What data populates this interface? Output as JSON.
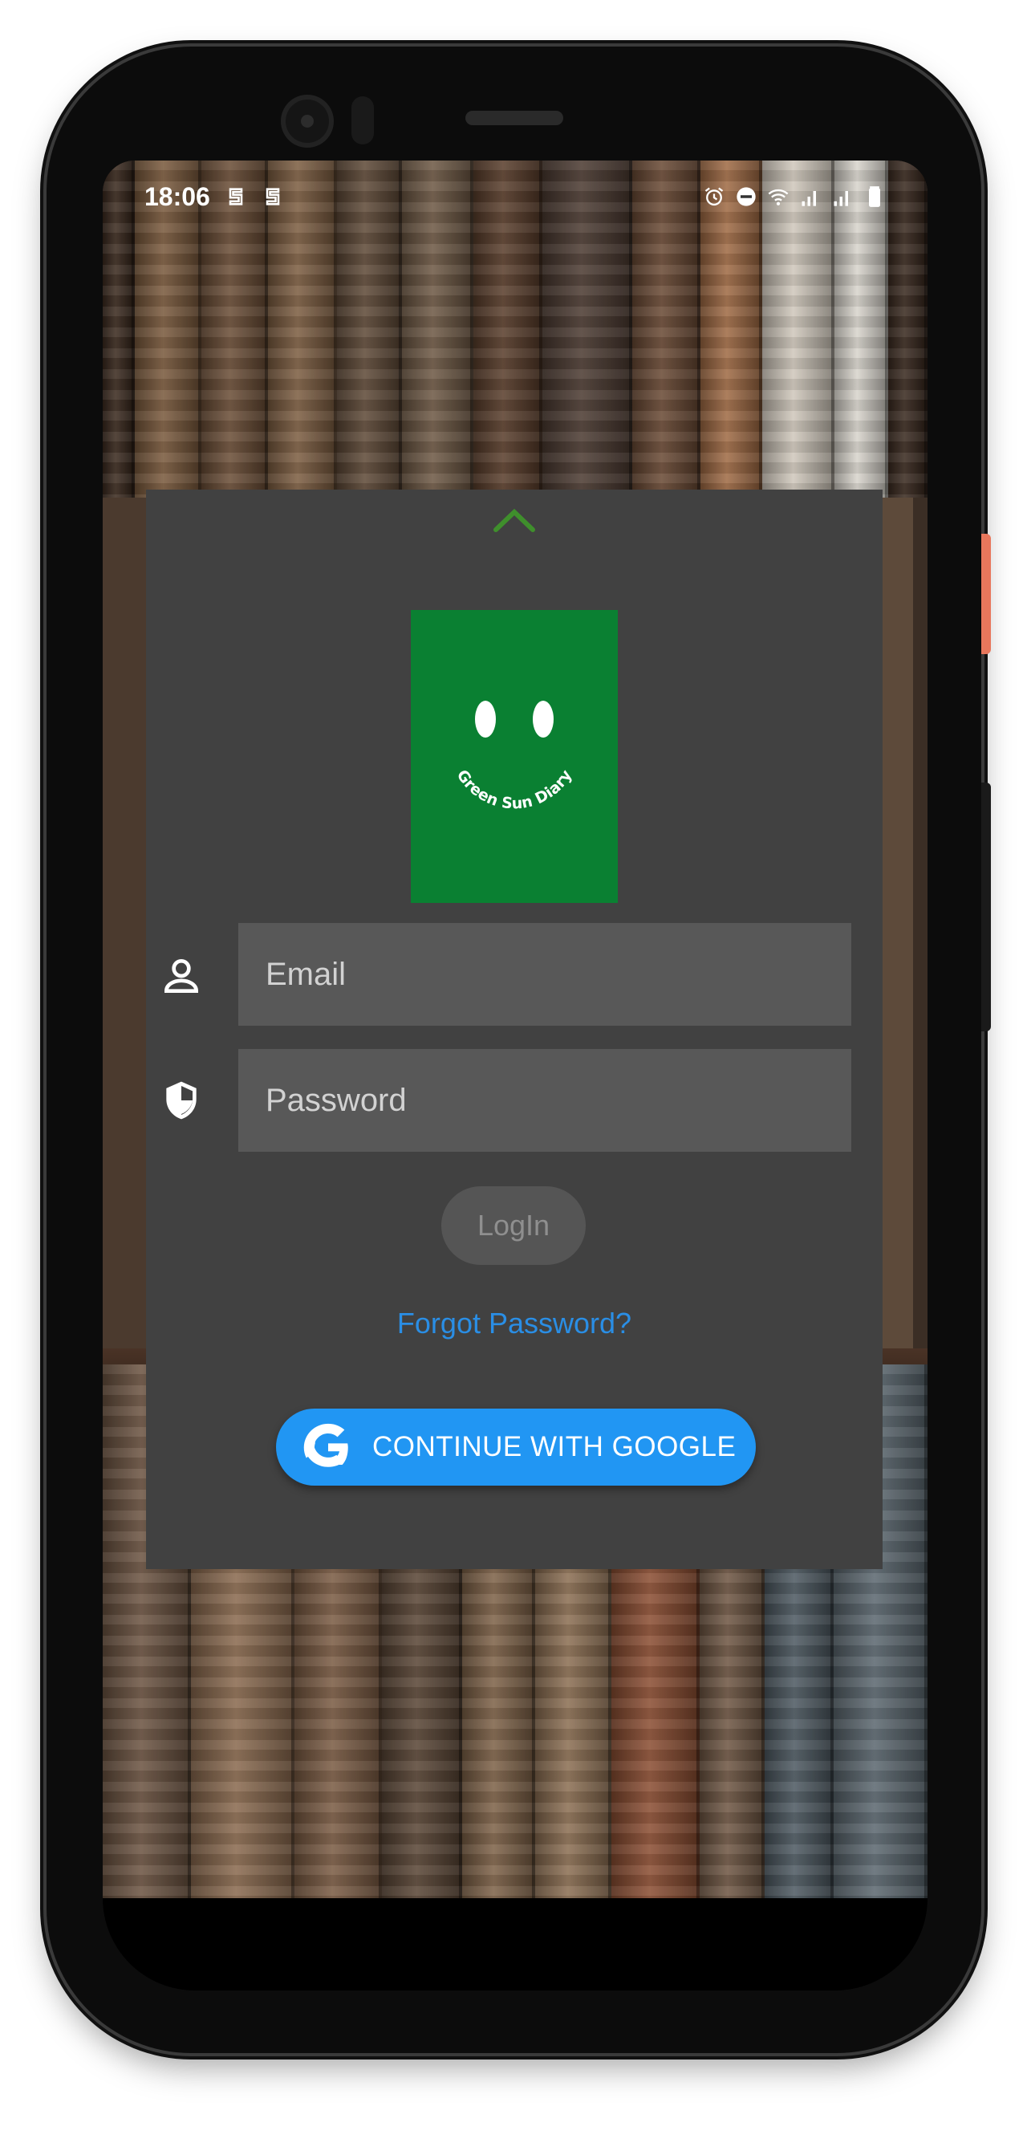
{
  "status_bar": {
    "time": "18:06"
  },
  "card": {
    "logo_text": "Green Sun Diary",
    "email_placeholder": "Email",
    "password_placeholder": "Password",
    "login_label": "LogIn",
    "forgot_password_label": "Forgot Password?",
    "google_label": "CONTINUE WITH GOOGLE"
  },
  "colors": {
    "card_background": "#414141",
    "logo_background": "#0a8032",
    "accent_blue": "#2196f3",
    "link_blue": "#2a8ee5",
    "chevron_green": "#3f8f2c"
  },
  "icons": {
    "status_left": [
      "s-notification-icon",
      "s-notification-icon"
    ],
    "status_right": [
      "alarm-icon",
      "do-not-disturb-icon",
      "wifi-icon",
      "signal-icon",
      "signal-icon",
      "battery-icon"
    ],
    "navigation": [
      "back-icon",
      "home-icon",
      "menu-icon"
    ]
  }
}
